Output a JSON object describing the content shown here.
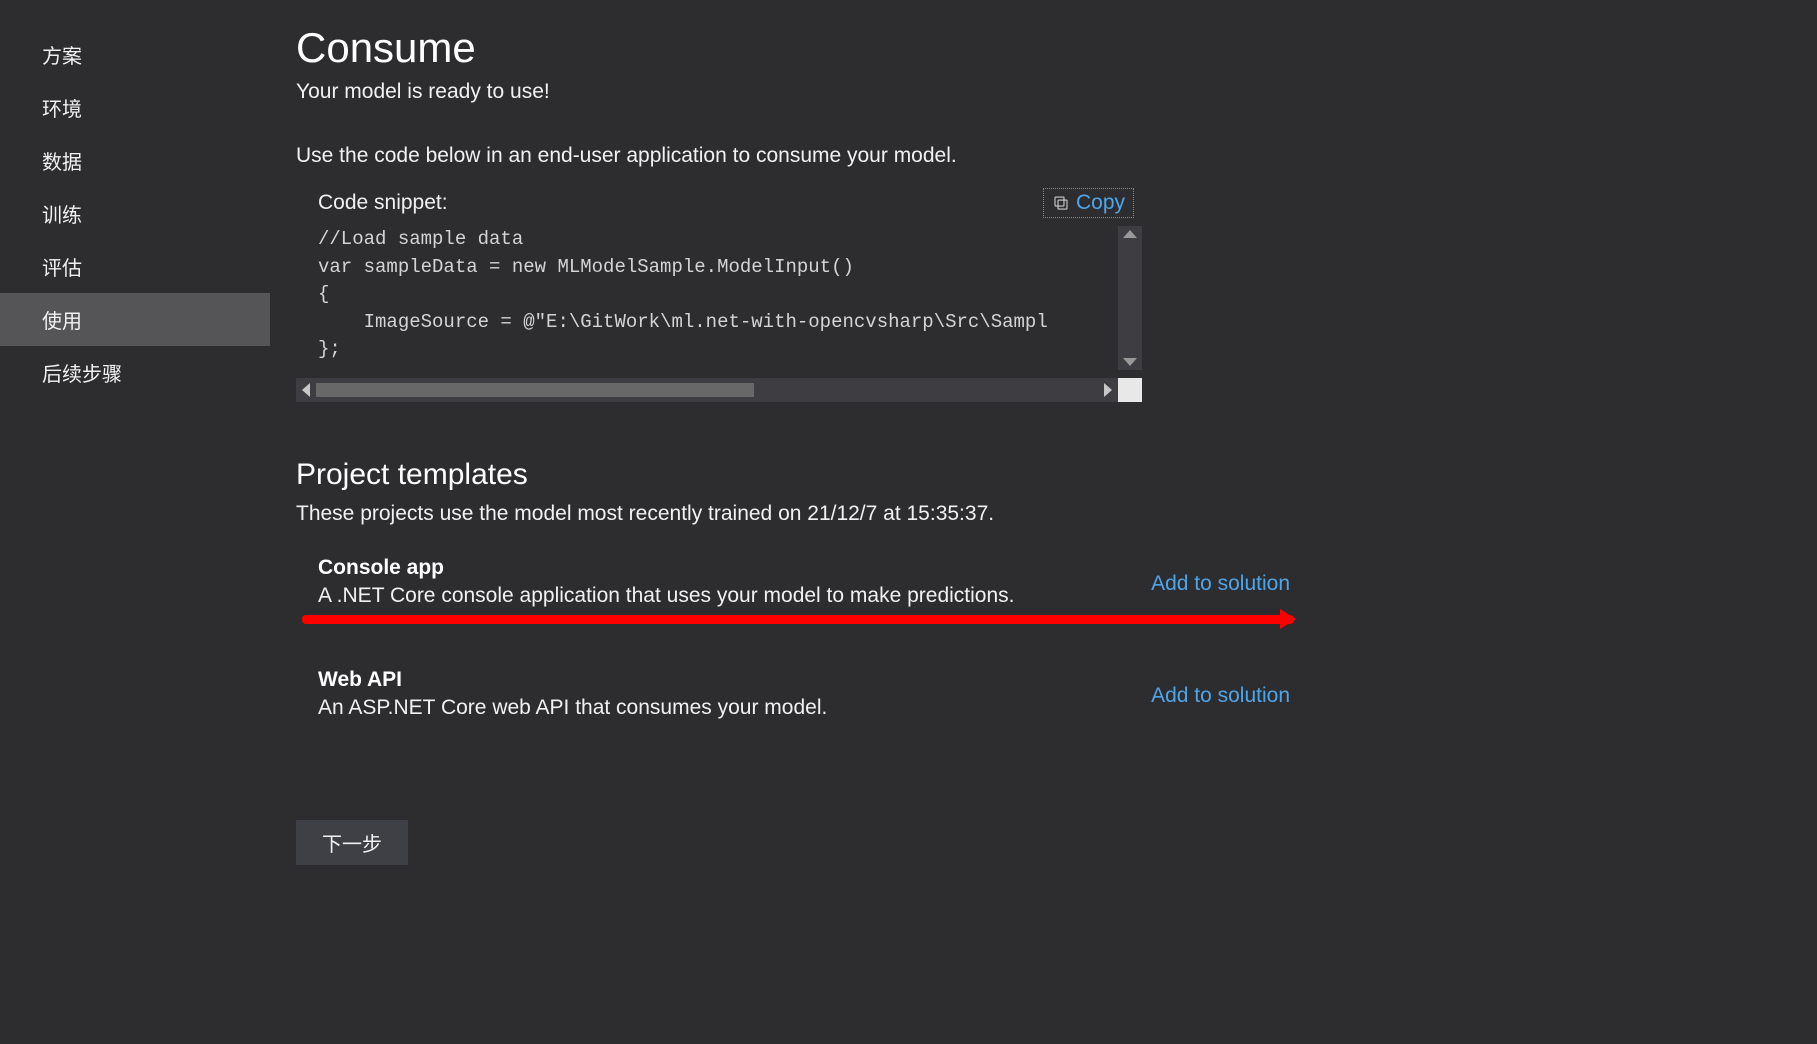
{
  "sidebar": {
    "items": [
      {
        "label": "方案",
        "active": false
      },
      {
        "label": "环境",
        "active": false
      },
      {
        "label": "数据",
        "active": false
      },
      {
        "label": "训练",
        "active": false
      },
      {
        "label": "评估",
        "active": false
      },
      {
        "label": "使用",
        "active": true
      },
      {
        "label": "后续步骤",
        "active": false
      }
    ]
  },
  "main": {
    "title": "Consume",
    "subtitle": "Your model is ready to use!",
    "instruction": "Use the code below in an end-user application to consume your model.",
    "snippet_label": "Code snippet:",
    "copy_label": "Copy",
    "code": "//Load sample data\nvar sampleData = new MLModelSample.ModelInput()\n{\n    ImageSource = @\"E:\\GitWork\\ml.net-with-opencvsharp\\Src\\Sampl\n};",
    "templates_title": "Project templates",
    "templates_desc": "These projects use the model most recently trained on 21/12/7 at 15:35:37.",
    "templates": [
      {
        "name": "Console app",
        "desc": "A .NET Core console application that uses your model to make predictions.",
        "action": "Add to solution",
        "highlight": true
      },
      {
        "name": "Web API",
        "desc": "An ASP.NET Core web API that consumes your model.",
        "action": "Add to solution",
        "highlight": false
      }
    ],
    "next_button": "下一步"
  }
}
